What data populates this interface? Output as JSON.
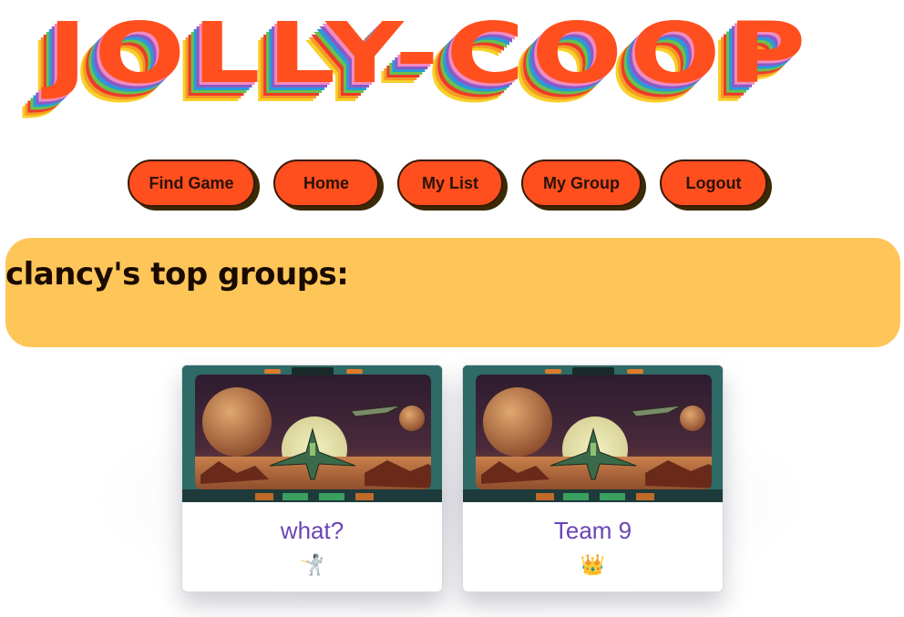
{
  "logo": {
    "text": "JOLLY-COOP"
  },
  "nav": [
    {
      "label": "Find Game"
    },
    {
      "label": "Home"
    },
    {
      "label": "My List"
    },
    {
      "label": "My Group"
    },
    {
      "label": "Logout"
    }
  ],
  "banner": {
    "title": "clancy's top groups:"
  },
  "groups": [
    {
      "name": "what?",
      "emoji": "🤺",
      "image_icon": "spaceship-cockpit-image"
    },
    {
      "name": "Team 9",
      "emoji": "👑",
      "image_icon": "spaceship-cockpit-image"
    }
  ],
  "colors": {
    "nav_button": "#ff4f1f",
    "banner": "#fec659",
    "card_title": "#6a45b6",
    "logo_front": "#ff4f1f"
  }
}
